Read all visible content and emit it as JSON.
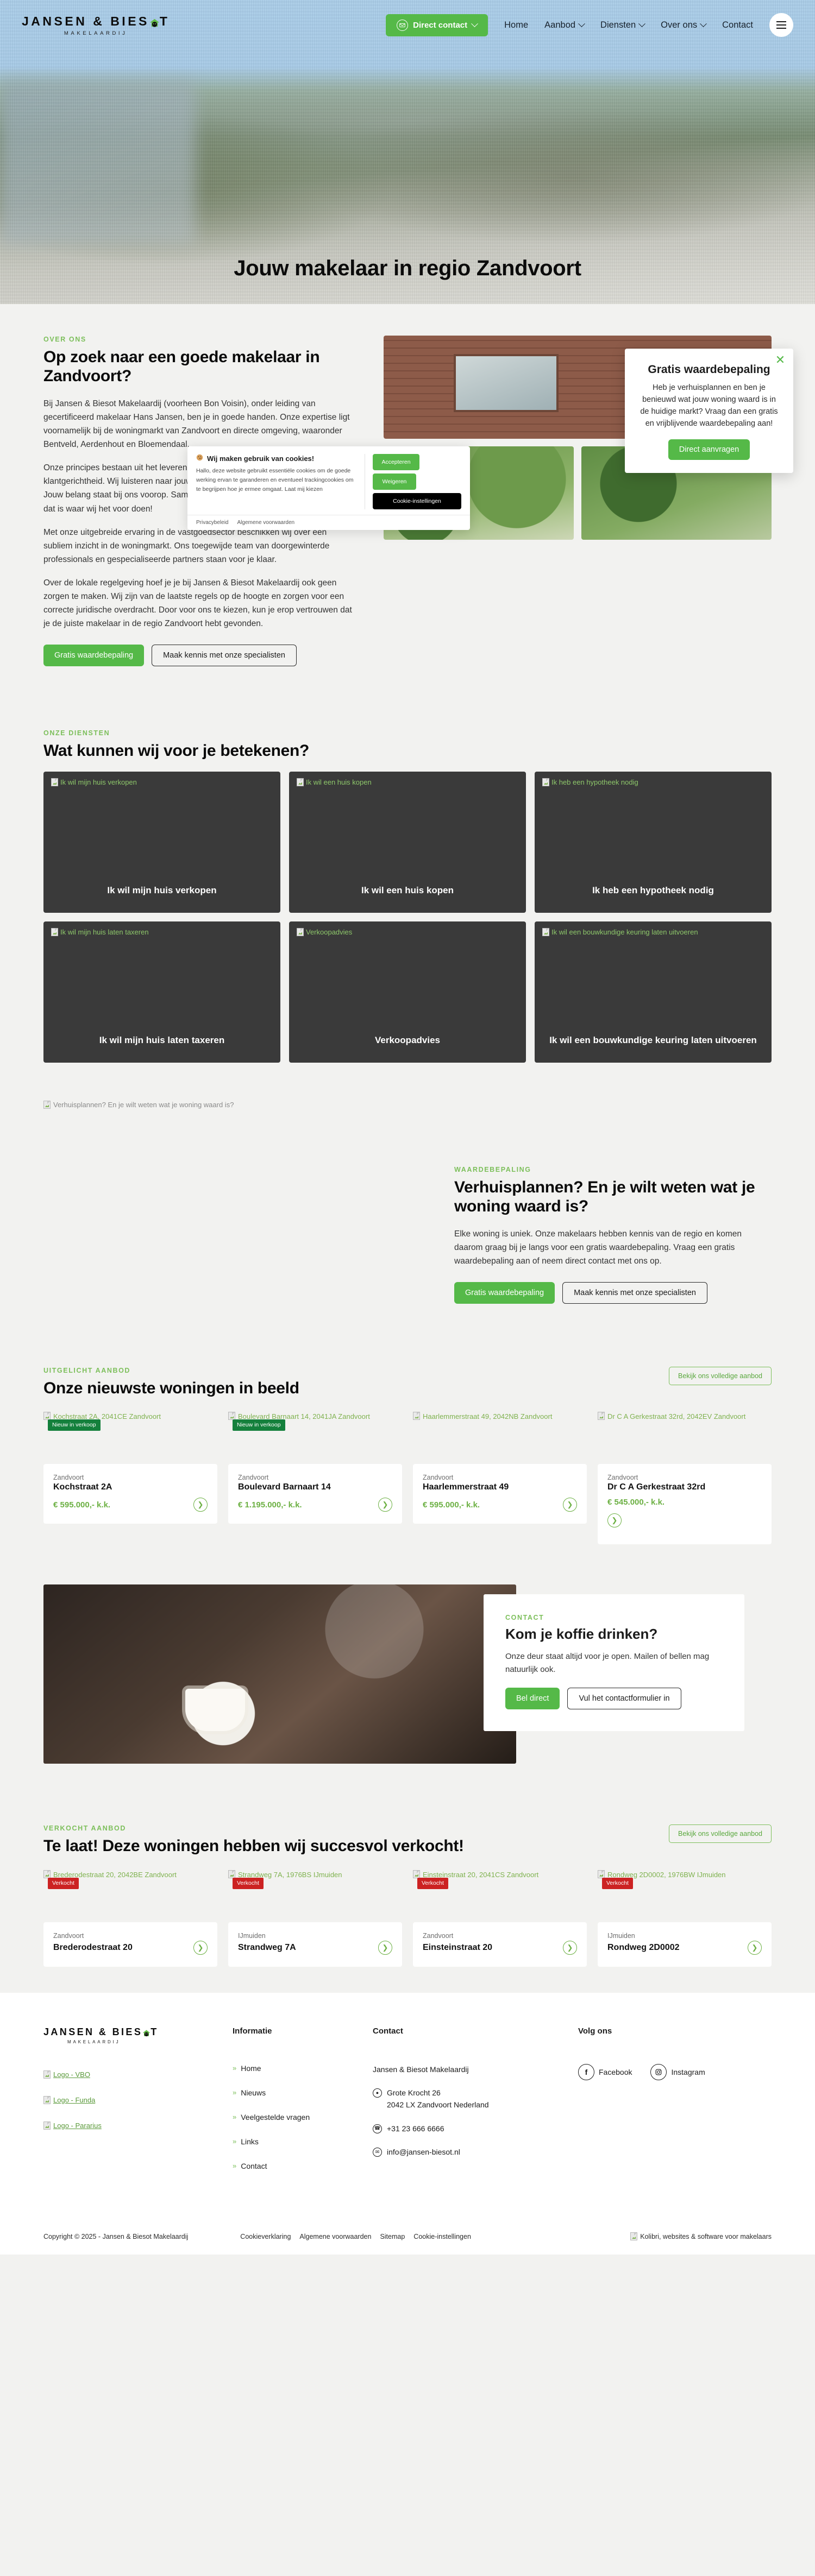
{
  "brand": {
    "name_main": "JANSEN & BIESOT",
    "name_sub": "MAKELAARDIJ"
  },
  "nav": {
    "direct_contact": "Direct contact",
    "items": [
      {
        "label": "Home",
        "caret": false
      },
      {
        "label": "Aanbod",
        "caret": true
      },
      {
        "label": "Diensten",
        "caret": true
      },
      {
        "label": "Over ons",
        "caret": true
      },
      {
        "label": "Contact",
        "caret": false
      }
    ]
  },
  "hero": {
    "title": "Jouw makelaar in regio Zandvoort"
  },
  "about": {
    "eyebrow": "OVER ONS",
    "title": "Op zoek naar een goede makelaar in Zandvoort?",
    "p1": "Bij Jansen & Biesot Makelaardij (voorheen Bon Voisin), onder leiding van gecertificeerd makelaar Hans Jansen, ben je in goede handen. Onze expertise ligt voornamelijk bij de woningmarkt van Zandvoort en directe omgeving, waaronder Bentveld, Aerdenhout en Bloemendaal.",
    "p2": "Onze principes bestaan uit het leveren van kwaliteit, eerlijkheid, transparantie en klantgerichtheid. Wij luisteren naar jouw wensen en zijn er voor jou als persoon. Jouw belang staat bij ons voorop. Samen met jou tot een mooi resultaat komen, dat is waar wij het voor doen!",
    "p3": "Met onze uitgebreide ervaring in de vastgoedsector beschikken wij over een subliem inzicht in de woningmarkt. Ons toegewijde team van doorgewinterde professionals en gespecialiseerde partners staan voor je klaar.",
    "p4": "Over de lokale regelgeving hoef je je bij Jansen & Biesot Makelaardij ook geen zorgen te maken. Wij zijn van de laatste regels op de hoogte en zorgen voor een correcte juridische overdracht. Door voor ons te kiezen, kun je erop vertrouwen dat je de juiste makelaar in de regio Zandvoort hebt gevonden.",
    "btn_primary": "Gratis waardebepaling",
    "btn_secondary": "Maak kennis met onze specialisten"
  },
  "popup": {
    "title": "Gratis waardebepaling",
    "body": "Heb je verhuisplannen en ben je benieuwd wat jouw woning waard is in de huidige markt? Vraag dan een gratis en vrijblijvende waardebepaling aan!",
    "button": "Direct aanvragen",
    "close": "✕"
  },
  "cookies": {
    "title": "Wij maken gebruik van cookies!",
    "body": "Hallo, deze website gebruikt essentiële cookies om de goede werking ervan te garanderen en eventueel trackingcookies om te begrijpen hoe je ermee omgaat. Laat mij kiezen",
    "accept": "Accepteren",
    "refuse": "Weigeren",
    "settings": "Cookie-instellingen",
    "links": [
      "Privacybeleid",
      "Algemene voorwaarden"
    ]
  },
  "services": {
    "eyebrow": "ONZE DIENSTEN",
    "title": "Wat kunnen wij voor je betekenen?",
    "cards": [
      {
        "alt": "Ik wil mijn huis verkopen",
        "label": "Ik wil mijn huis verkopen"
      },
      {
        "alt": "Ik wil een huis kopen",
        "label": "Ik wil een huis kopen"
      },
      {
        "alt": "Ik heb een hypotheek nodig",
        "label": "Ik heb een hypotheek nodig"
      },
      {
        "alt": "Ik wil mijn huis laten taxeren",
        "label": "Ik wil mijn huis laten taxeren"
      },
      {
        "alt": "Verkoopadvies",
        "label": "Verkoopadvies"
      },
      {
        "alt": "Ik wil een bouwkundige keuring laten uitvoeren",
        "label": "Ik wil een bouwkundige keuring laten uitvoeren"
      }
    ]
  },
  "valuation": {
    "image_alt": "Verhuisplannen? En je wilt weten wat je woning waard is?",
    "eyebrow": "WAARDEBEPALING",
    "title": "Verhuisplannen? En je wilt weten wat je woning waard is?",
    "body": "Elke woning is uniek. Onze makelaars hebben kennis van de regio en komen daarom graag bij je langs voor een gratis waardebepaling. Vraag een gratis waardebepaling aan of neem direct contact met ons op.",
    "btn_primary": "Gratis waardebepaling",
    "btn_secondary": "Maak kennis met onze specialisten"
  },
  "featured": {
    "eyebrow": "UITGELICHT AANBOD",
    "title": "Onze nieuwste woningen in beeld",
    "cta": "Bekijk ons volledige aanbod",
    "items": [
      {
        "alt": "Kochstraat 2A, 2041CE Zandvoort",
        "badge": "Nieuw in verkoop",
        "city": "Zandvoort",
        "street": "Kochstraat 2A",
        "price": "€ 595.000,- k.k."
      },
      {
        "alt": "Boulevard Barnaart 14, 2041JA Zandvoort",
        "badge": "Nieuw in verkoop",
        "city": "Zandvoort",
        "street": "Boulevard Barnaart 14",
        "price": "€ 1.195.000,- k.k."
      },
      {
        "alt": "Haarlemmerstraat 49, 2042NB Zandvoort",
        "badge": "",
        "city": "Zandvoort",
        "street": "Haarlemmerstraat 49",
        "price": "€ 595.000,- k.k."
      },
      {
        "alt": "Dr C A Gerkestraat 32rd, 2042EV Zandvoort",
        "badge": "",
        "city": "Zandvoort",
        "street": "Dr C A Gerkestraat 32rd",
        "price": "€ 545.000,- k.k."
      }
    ]
  },
  "contact_band": {
    "eyebrow": "CONTACT",
    "title": "Kom je koffie drinken?",
    "body": "Onze deur staat altijd voor je open. Mailen of bellen mag natuurlijk ook.",
    "btn_primary": "Bel direct",
    "btn_secondary": "Vul het contactformulier in"
  },
  "sold": {
    "eyebrow": "VERKOCHT AANBOD",
    "title": "Te laat! Deze woningen hebben wij succesvol verkocht!",
    "cta": "Bekijk ons volledige aanbod",
    "items": [
      {
        "alt": "Brederodestraat 20, 2042BE Zandvoort",
        "badge": "Verkocht",
        "city": "Zandvoort",
        "street": "Brederodestraat 20"
      },
      {
        "alt": "Strandweg 7A, 1976BS IJmuiden",
        "badge": "Verkocht",
        "city": "IJmuiden",
        "street": "Strandweg 7A"
      },
      {
        "alt": "Einsteinstraat 20, 2041CS Zandvoort",
        "badge": "Verkocht",
        "city": "Zandvoort",
        "street": "Einsteinstraat 20"
      },
      {
        "alt": "Rondweg 2D0002, 1976BW IJmuiden",
        "badge": "Verkocht",
        "city": "IJmuiden",
        "street": "Rondweg 2D0002"
      }
    ]
  },
  "footer": {
    "partners": [
      "Logo - VBO",
      "Logo - Funda",
      "Logo - Pararius"
    ],
    "info_title": "Informatie",
    "info_links": [
      "Home",
      "Nieuws",
      "Veelgestelde vragen",
      "Links",
      "Contact"
    ],
    "contact_title": "Contact",
    "company": "Jansen & Biesot Makelaardij",
    "address_line1": "Grote Krocht 26",
    "address_line2": "2042 LX Zandvoort Nederland",
    "phone": "+31 23 666 6666",
    "email": "info@jansen-biesot.nl",
    "follow_title": "Volg ons",
    "socials": [
      {
        "label": "Facebook",
        "glyph": "f"
      },
      {
        "label": "Instagram",
        "glyph": "▢"
      }
    ],
    "copyright": "Copyright © 2025 - Jansen & Biesot Makelaardij",
    "legal": [
      "Cookieverklaring",
      "Algemene voorwaarden",
      "Sitemap",
      "Cookie-instellingen"
    ],
    "kolibri": "Kolibri, websites & software voor makelaars"
  },
  "colors": {
    "green": "#55b948",
    "green_light": "#7cbf5a",
    "sold_red": "#cc2222",
    "badge_green": "#14803c"
  }
}
